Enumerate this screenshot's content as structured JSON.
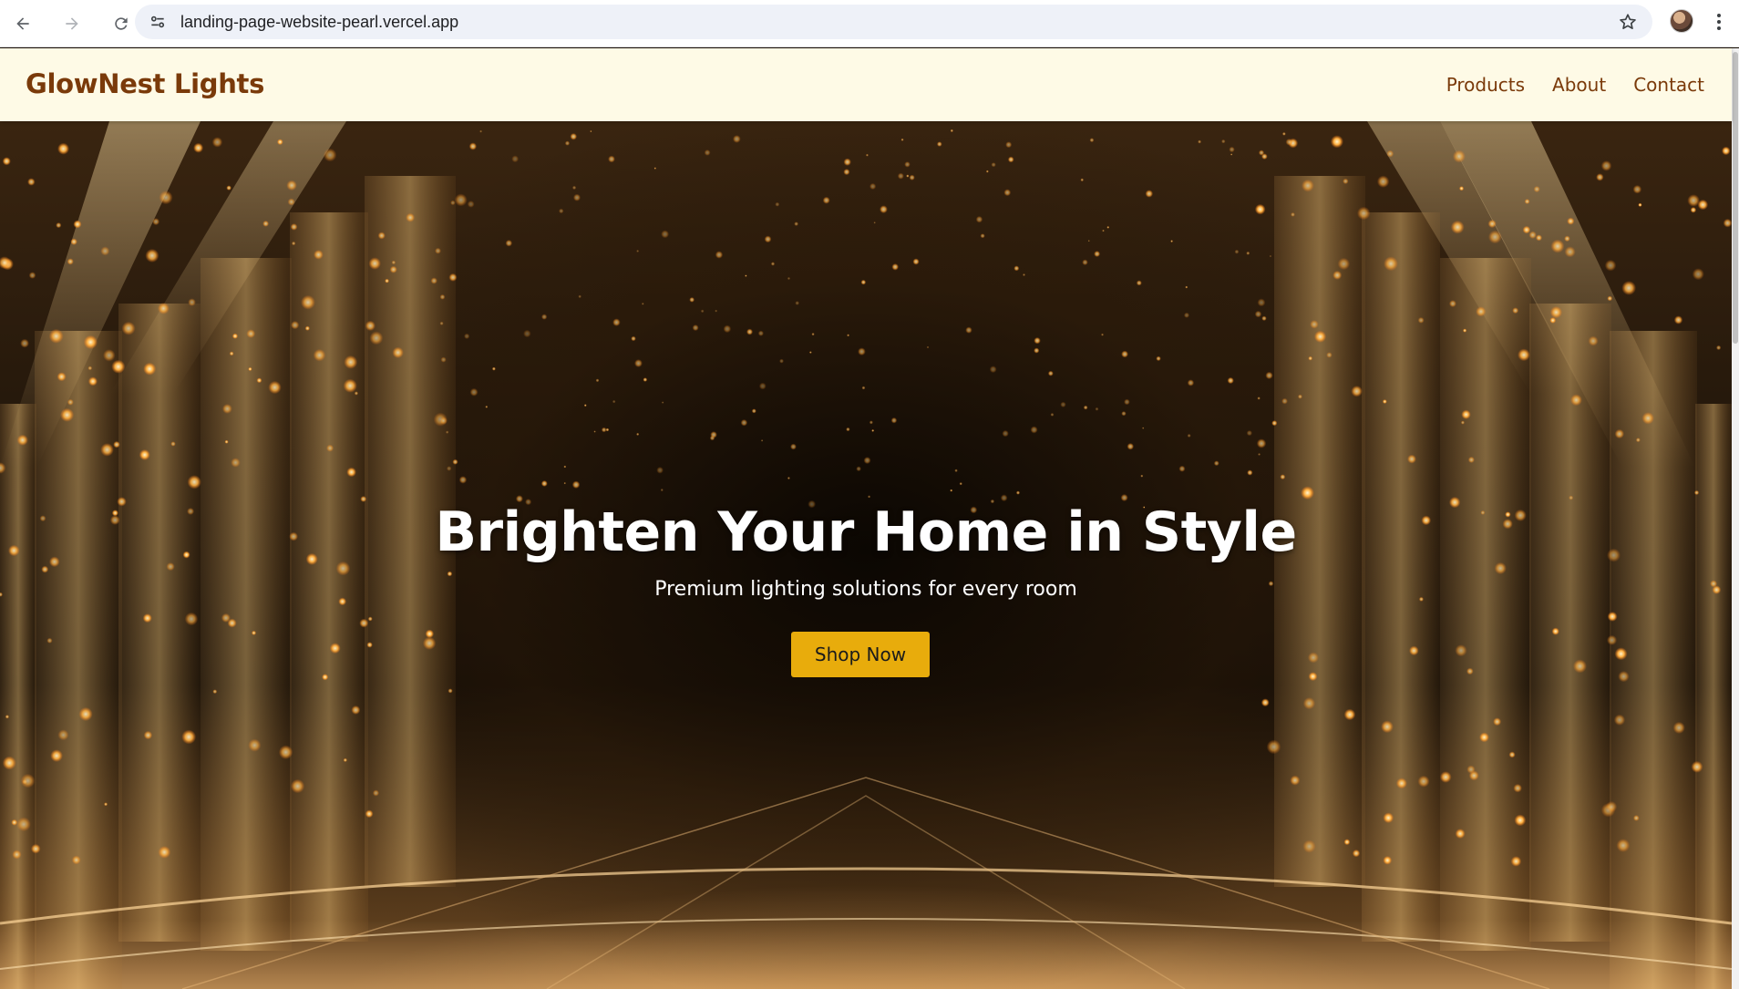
{
  "browser": {
    "url": "landing-page-website-pearl.vercel.app",
    "icons": {
      "back": "arrow-left-icon",
      "forward": "arrow-right-icon",
      "reload": "reload-icon",
      "site_info": "tune-icon",
      "bookmark": "star-icon",
      "menu": "kebab-menu-icon"
    }
  },
  "site": {
    "brand": "GlowNest Lights",
    "nav": [
      {
        "label": "Products"
      },
      {
        "label": "About"
      },
      {
        "label": "Contact"
      }
    ],
    "colors": {
      "header_bg": "#fefae6",
      "brand_text": "#7a3a0a",
      "cta_bg": "#e8ac0c"
    }
  },
  "hero": {
    "headline": "Brighten Your Home in Style",
    "subheadline": "Premium lighting solutions for every room",
    "cta_label": "Shop Now"
  }
}
